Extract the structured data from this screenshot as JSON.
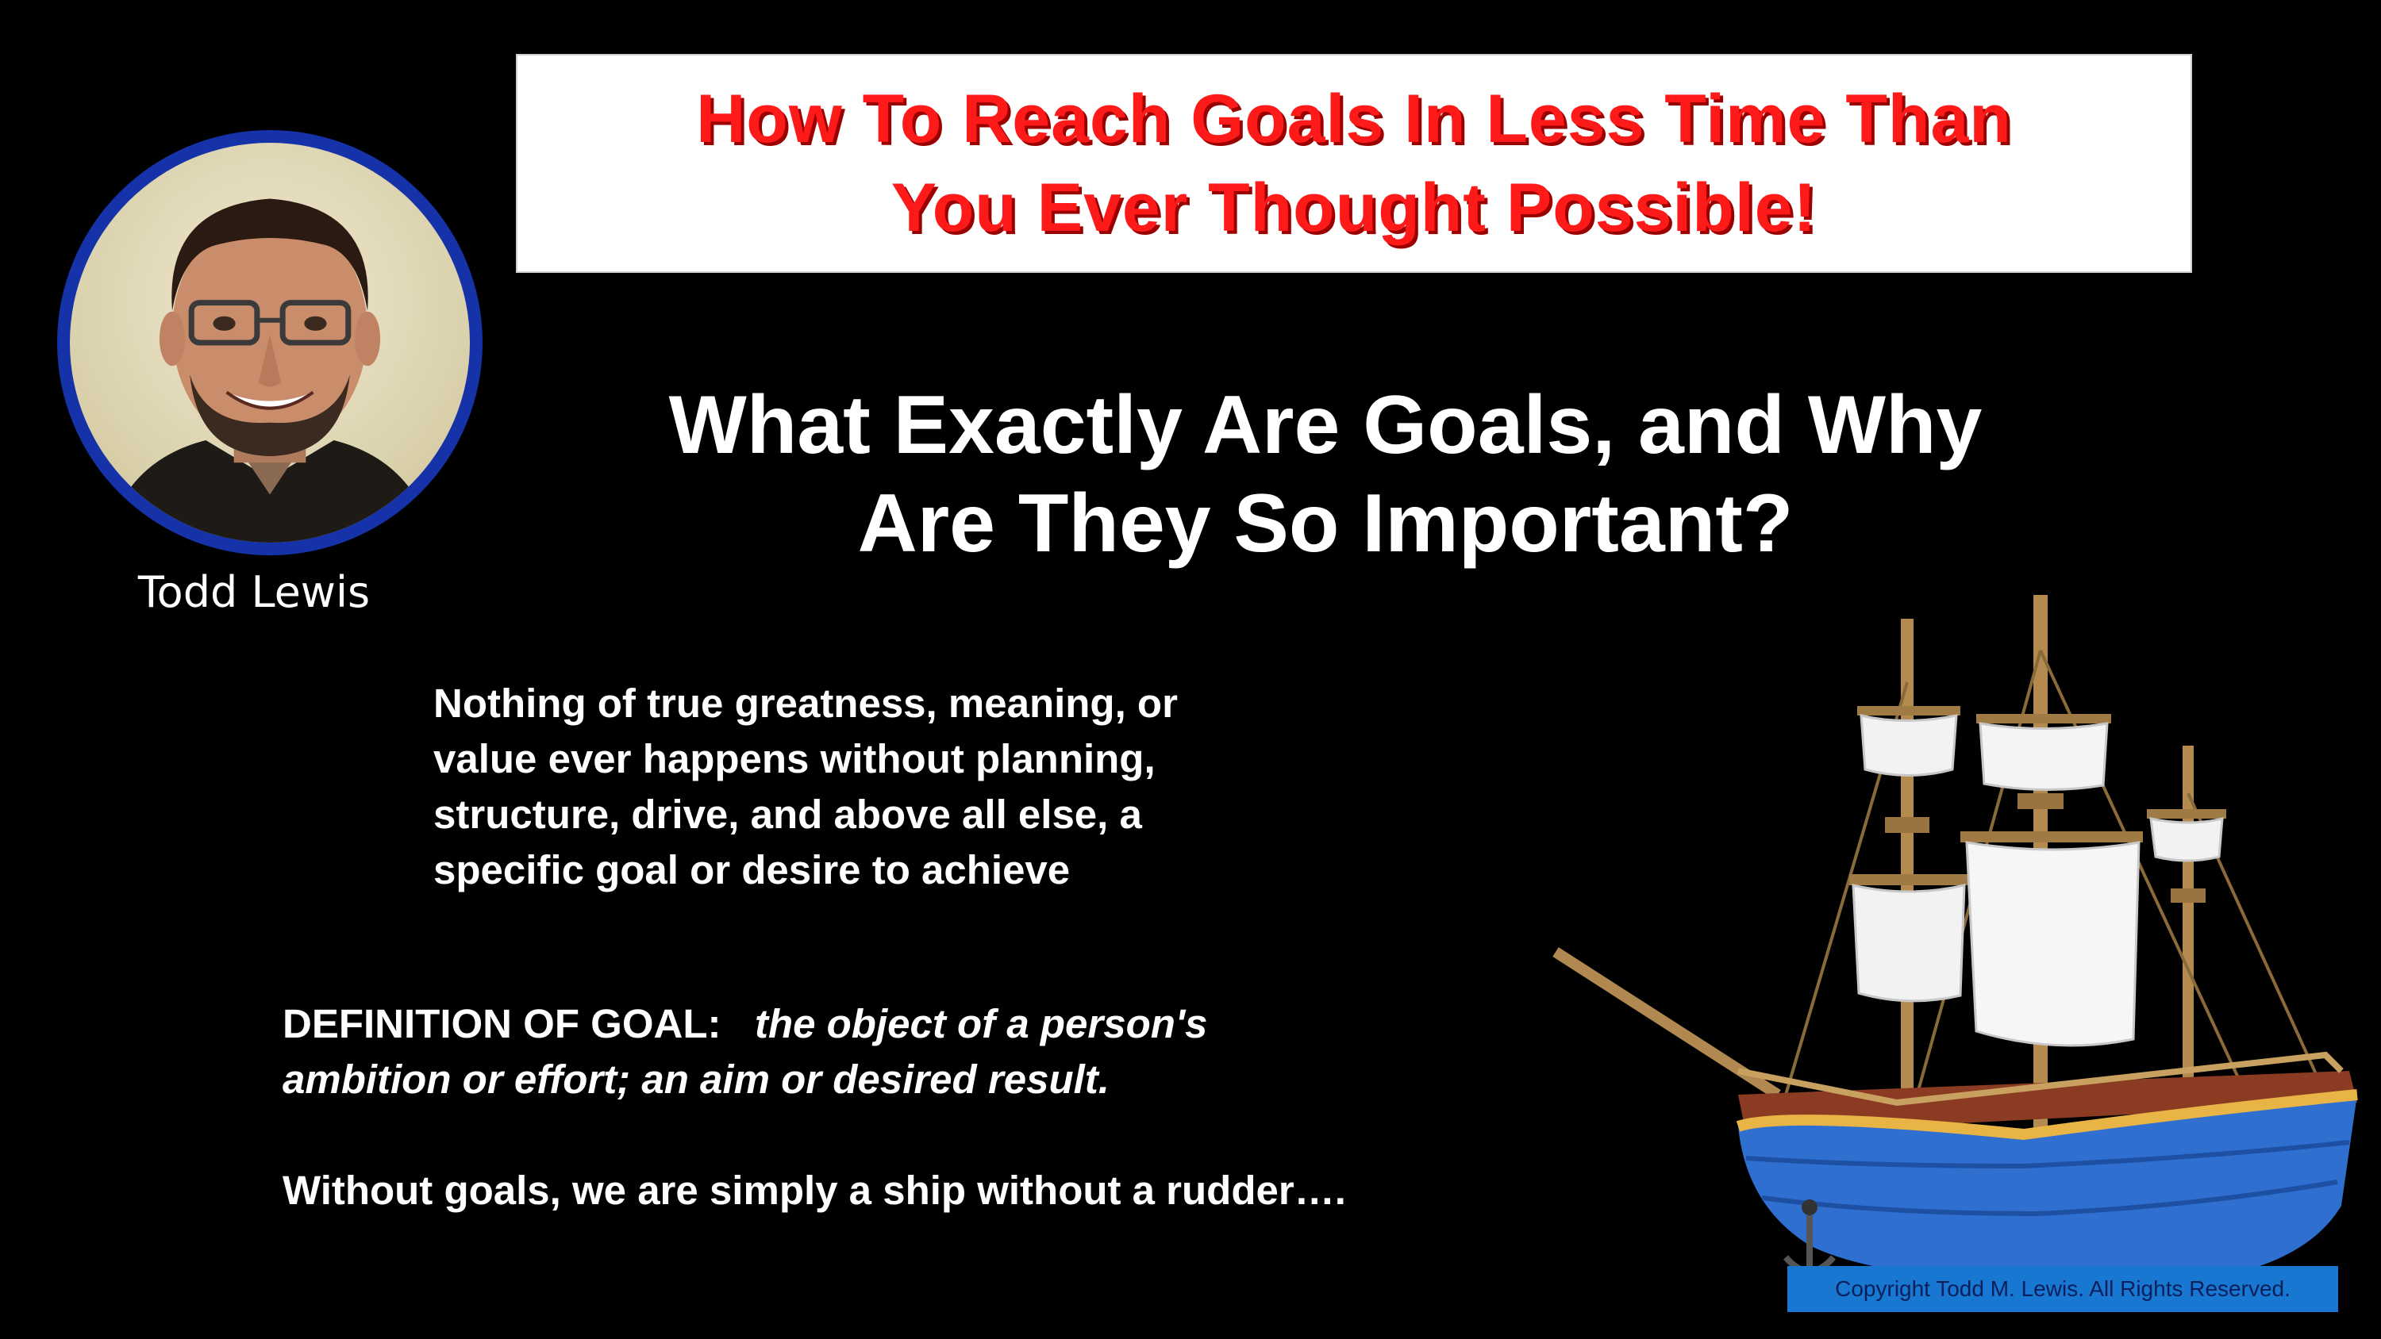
{
  "title": {
    "line1": "How To Reach Goals In Less Time Than",
    "line2": "You Ever Thought Possible!"
  },
  "presenter": {
    "name": "Todd Lewis"
  },
  "heading": {
    "line1": "What Exactly Are Goals, and Why",
    "line2": "Are They So Important?"
  },
  "intro": {
    "lines": [
      "Nothing of true greatness, meaning, or",
      "value ever happens without planning,",
      "structure, drive, and above all else, a",
      "specific goal or desire to achieve"
    ]
  },
  "definition": {
    "label": "DEFINITION OF GOAL:",
    "text_line1": "the object of a person's",
    "text_line2": "ambition or effort; an aim or desired result."
  },
  "closing": "Without goals, we are simply a ship without a rudder….",
  "copyright": "Copyright Todd M. Lewis.  All Rights Reserved.",
  "colors": {
    "background": "#000000",
    "title_red": "#ff1a1a",
    "ring_blue": "#1632a8",
    "copyright_bar": "#1877d0"
  }
}
